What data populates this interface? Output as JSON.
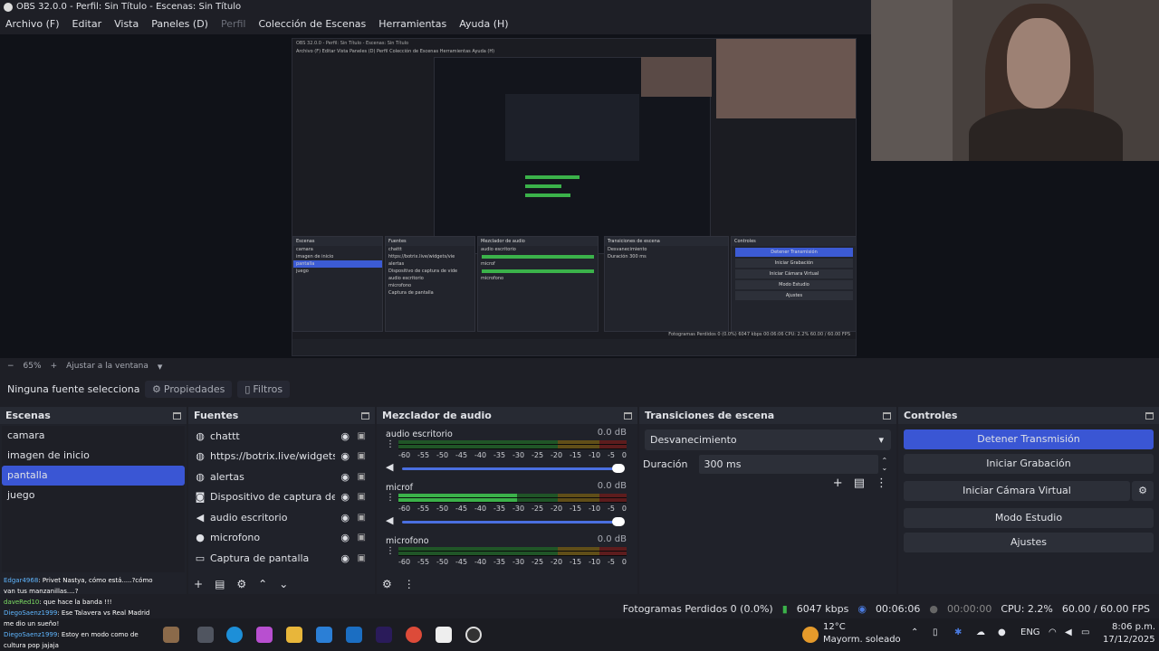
{
  "window": {
    "title": "OBS 32.0.0 - Perfil: Sin Título - Escenas: Sin Título"
  },
  "menu": [
    "Archivo (F)",
    "Editar",
    "Vista",
    "Paneles (D)",
    "Perfil",
    "Colección de Escenas",
    "Herramientas",
    "Ayuda (H)"
  ],
  "nested_preview": {
    "title": "OBS 32.0.0 - Perfil: Sin Título - Escenas: Sin Título",
    "menu": "Archivo (F)   Editar   Vista   Paneles (D)   Perfil   Colección de Escenas   Herramientas   Ayuda (H)",
    "zoom": "65%   Ajustar a la ventana",
    "source_bar": "Ninguna fuente seleccionada",
    "scenes": [
      "camara",
      "imagen de inicio",
      "pantalla",
      "juego"
    ],
    "sources": [
      "chattt",
      "https://botrix.live/widgets/vie",
      "alertas",
      "Dispositivo de captura de vide",
      "audio escritorio",
      "microfono",
      "Captura de pantalla"
    ],
    "mixer": [
      "audio escritorio",
      "microf",
      "microfono"
    ],
    "transitions": [
      "Desvanecimiento",
      "Duración",
      "300 ms"
    ],
    "controls": [
      "Detener Transmisión",
      "Iniciar Grabación",
      "Iniciar Cámara Virtual",
      "Modo Estudio",
      "Ajustes"
    ],
    "status": "Fotogramas Perdidos 0 (0.0%)   6047 kbps   00:06:06   CPU: 2.2%   60.00 / 60.00 FPS",
    "chat": "Edgar4968 : Privet Nastya, cómo está...",
    "weather": "12°C Mayorm. soleado",
    "clock": "8:06 p.m. 17/12/2025"
  },
  "zoom": {
    "minus": "−",
    "level": "65%",
    "plus": "+",
    "fit": "Ajustar a la ventana",
    "dropdown": "▾"
  },
  "source_bar": {
    "label": "Ninguna fuente selecciona",
    "properties": "Propiedades",
    "filters": "Filtros"
  },
  "scenes": {
    "title": "Escenas",
    "items": [
      "camara",
      "imagen de inicio",
      "pantalla",
      "juego"
    ],
    "selected_index": 2
  },
  "sources": {
    "title": "Fuentes",
    "items": [
      {
        "name": "chattt",
        "icon": "globe-icon"
      },
      {
        "name": "https://botrix.live/widgets/view",
        "icon": "globe-icon"
      },
      {
        "name": "alertas",
        "icon": "globe-icon"
      },
      {
        "name": "Dispositivo de captura de video",
        "icon": "camera-icon"
      },
      {
        "name": "audio escritorio",
        "icon": "speaker-icon"
      },
      {
        "name": "microfono",
        "icon": "microphone-icon"
      },
      {
        "name": "Captura de pantalla",
        "icon": "monitor-icon"
      }
    ]
  },
  "mixer": {
    "title": "Mezclador de audio",
    "ticks": [
      "-60",
      "-55",
      "-50",
      "-45",
      "-40",
      "-35",
      "-30",
      "-25",
      "-20",
      "-15",
      "-10",
      "-5",
      "0"
    ],
    "channels": [
      {
        "name": "audio escritorio",
        "db": "0.0 dB",
        "level": 0.0
      },
      {
        "name": "microf",
        "db": "0.0 dB",
        "level": 0.52
      },
      {
        "name": "microfono",
        "db": "0.0 dB",
        "level": 0.0
      }
    ]
  },
  "transitions": {
    "title": "Transiciones de escena",
    "select": "Desvanecimiento",
    "duration_label": "Duración",
    "duration_value": "300 ms"
  },
  "controls": {
    "title": "Controles",
    "buttons": [
      "Detener Transmisión",
      "Iniciar Grabación",
      "Iniciar Cámara Virtual",
      "Modo Estudio",
      "Ajustes"
    ]
  },
  "status": {
    "dropped": "Fotogramas Perdidos 0 (0.0%)",
    "bitrate": "6047 kbps",
    "stream_time": "00:06:06",
    "rec_time": "00:00:00",
    "cpu": "CPU: 2.2%",
    "fps": "60.00 / 60.00 FPS"
  },
  "chat": [
    {
      "user": "Edgar4968",
      "msg": ": Privet Nastya, cómo está.....?cómo van tus manzanillas....?"
    },
    {
      "user": "daveRed10",
      "msg": ": que hace la banda !!!"
    },
    {
      "user": "DiegoSaenz1999",
      "msg": ": Ese Talavera vs Real Madrid me dio un sueño!"
    },
    {
      "user": "DiegoSaenz1999",
      "msg": ": Estoy en modo como de cultura pop jajaja"
    }
  ],
  "taskbar": {
    "weather_temp": "12°C",
    "weather_desc": "Mayorm. soleado",
    "lang": "ENG",
    "time": "8:06 p.m.",
    "date": "17/12/2025"
  },
  "colors": {
    "accent": "#3a56d4",
    "panel": "#20222a",
    "meter_green": "#3bb24a",
    "meter_yellow": "#c9a227",
    "meter_red": "#c43434"
  }
}
